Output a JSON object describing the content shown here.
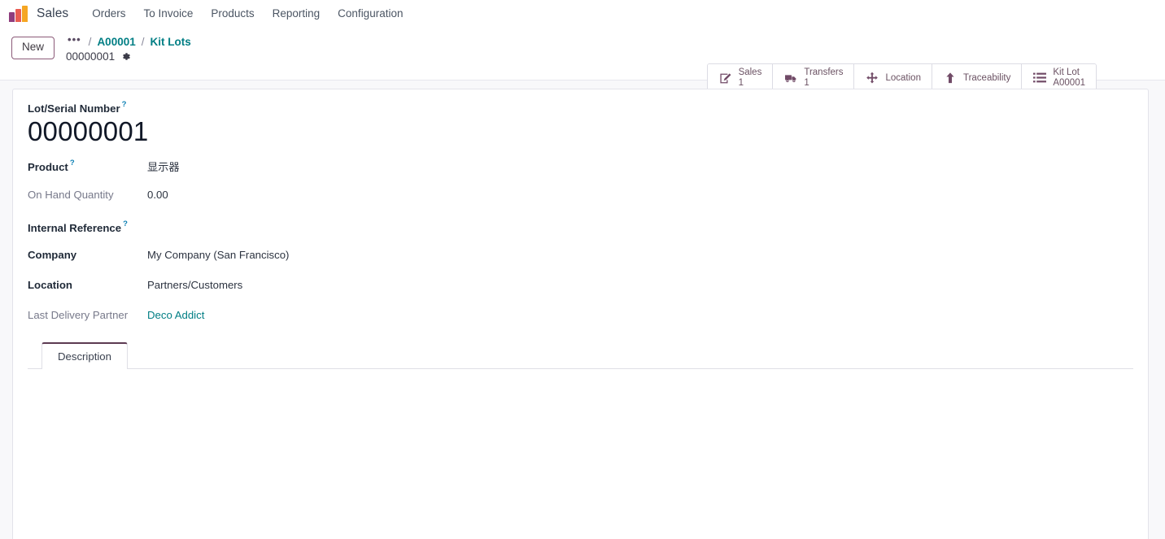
{
  "navbar": {
    "logo_icon": "odoo-sales-logo-icon",
    "logo_colors": [
      "#8f3d7e",
      "#e95c52",
      "#f5a623"
    ],
    "app_name": "Sales",
    "menu_items": [
      {
        "label": "Orders"
      },
      {
        "label": "To Invoice"
      },
      {
        "label": "Products"
      },
      {
        "label": "Reporting"
      },
      {
        "label": "Configuration"
      }
    ]
  },
  "control_panel": {
    "new_button_label": "New",
    "breadcrumb": {
      "ellipsis": "•••",
      "separator": "/",
      "items": [
        {
          "label": "A00001",
          "link": true
        },
        {
          "label": "Kit Lots",
          "link": true
        }
      ],
      "current": "00000001",
      "gear_icon": "gear-icon"
    },
    "stat_buttons": [
      {
        "icon": "pencil-square-icon",
        "label": "Sales",
        "value": "1"
      },
      {
        "icon": "truck-icon",
        "label": "Transfers",
        "value": "1"
      },
      {
        "icon": "arrows-move-icon",
        "label": "Location",
        "value": ""
      },
      {
        "icon": "arrow-up-icon",
        "label": "Traceability",
        "value": ""
      },
      {
        "icon": "list-ul-icon",
        "label": "Kit Lot",
        "value": "A00001"
      }
    ]
  },
  "form": {
    "title_field": {
      "label": "Lot/Serial Number",
      "help_marker": "?",
      "value": "00000001"
    },
    "fields": [
      {
        "label": "Product",
        "help_marker": "?",
        "value": "显示器",
        "label_style": "bold",
        "value_style": "text"
      },
      {
        "label": "On Hand Quantity",
        "help_marker": "",
        "value": "0.00",
        "label_style": "muted",
        "value_style": "text"
      },
      {
        "label": "Internal Reference",
        "help_marker": "?",
        "value": "",
        "label_style": "bold",
        "value_style": "text"
      },
      {
        "label": "Company",
        "help_marker": "",
        "value": "My Company (San Francisco)",
        "label_style": "bold",
        "value_style": "text"
      },
      {
        "label": "Location",
        "help_marker": "",
        "value": "Partners/Customers",
        "label_style": "bold",
        "value_style": "text"
      },
      {
        "label": "Last Delivery Partner",
        "help_marker": "",
        "value": "Deco Addict",
        "label_style": "muted",
        "value_style": "link"
      }
    ],
    "tabs": [
      {
        "label": "Description",
        "active": true
      }
    ],
    "tab_content": ""
  },
  "colors": {
    "accent": "#714b67",
    "link": "#017e84",
    "help": "#0b7fb3",
    "sheet_bg": "#f8f8fa"
  }
}
